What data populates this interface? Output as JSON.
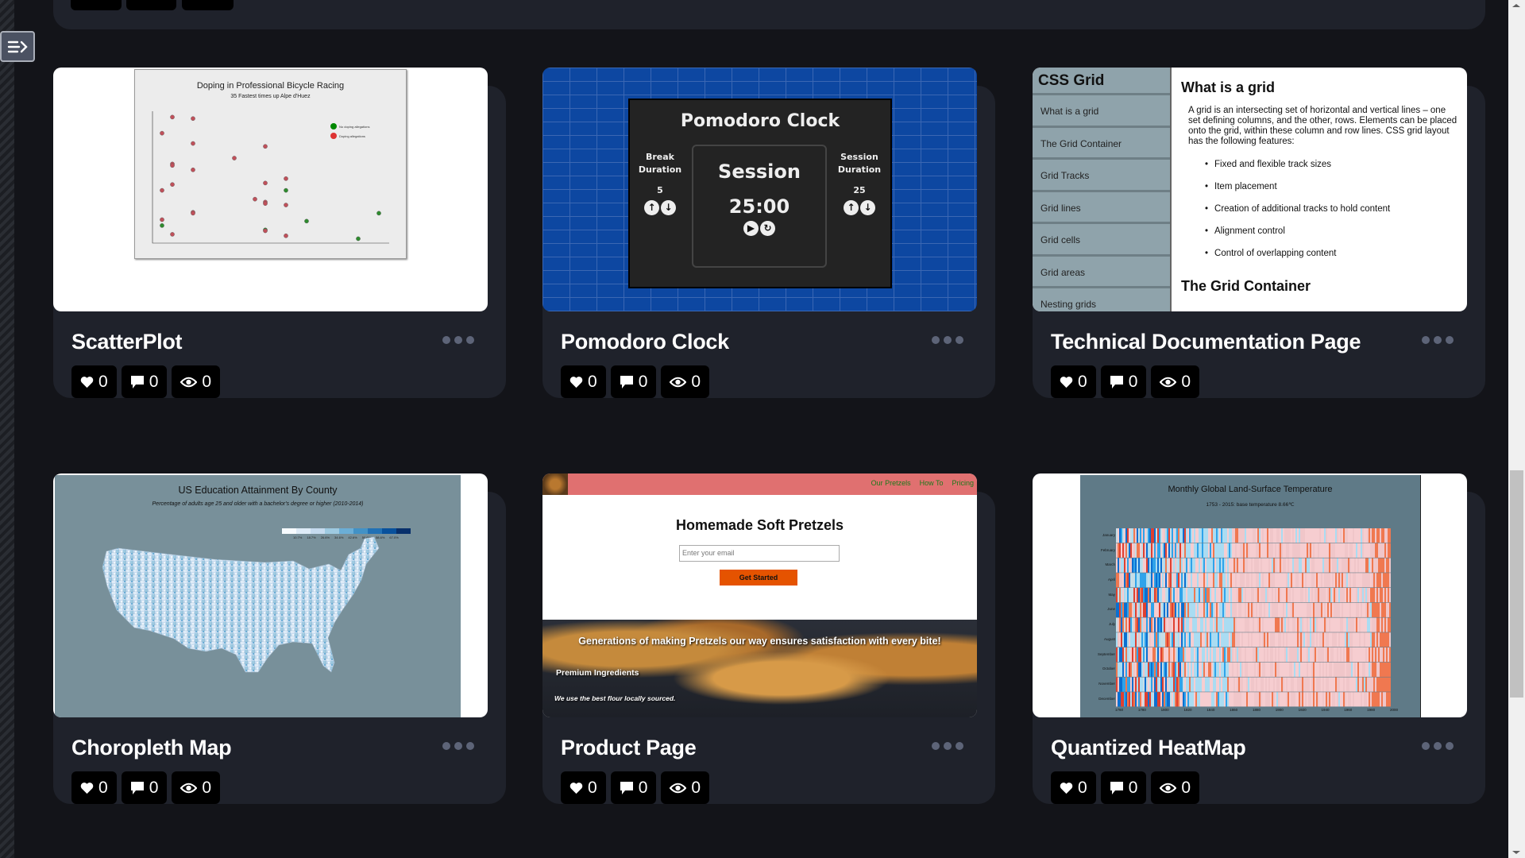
{
  "sidebar_toggle": {
    "icon": "menu-arrow-icon"
  },
  "cards": [
    {
      "title": "ScatterPlot",
      "likes": "0",
      "comments": "0",
      "views": "0"
    },
    {
      "title": "Pomodoro Clock",
      "likes": "0",
      "comments": "0",
      "views": "0"
    },
    {
      "title": "Technical Documentation Page",
      "likes": "0",
      "comments": "0",
      "views": "0"
    },
    {
      "title": "Choropleth Map",
      "likes": "0",
      "comments": "0",
      "views": "0"
    },
    {
      "title": "Product Page",
      "likes": "0",
      "comments": "0",
      "views": "0"
    },
    {
      "title": "Quantized HeatMap",
      "likes": "0",
      "comments": "0",
      "views": "0"
    }
  ],
  "scatter": {
    "title": "Doping in Professional Bicycle Racing",
    "subtitle": "35 Fastest times up Alpe d'Huez",
    "legend": [
      "No doping allegations",
      "Doping allegations"
    ],
    "colors": {
      "clean": "#2e8b2e",
      "doping": "#c0505a"
    },
    "points": [
      [
        1995,
        36.7,
        1
      ],
      [
        1997,
        36.75,
        1
      ],
      [
        1994,
        37.25,
        1
      ],
      [
        2004,
        37.7,
        1
      ],
      [
        1997,
        37.6,
        1
      ],
      [
        2001,
        38.1,
        1
      ],
      [
        1995,
        38.3,
        1
      ],
      [
        1995,
        38.35,
        1
      ],
      [
        1997,
        38.5,
        1
      ],
      [
        2006,
        38.8,
        1
      ],
      [
        2004,
        38.95,
        1
      ],
      [
        1995,
        39.0,
        1
      ],
      [
        1994,
        39.2,
        1
      ],
      [
        2006,
        39.2,
        0
      ],
      [
        2003,
        39.5,
        1
      ],
      [
        2004,
        39.6,
        1
      ],
      [
        2004,
        39.65,
        1
      ],
      [
        2006,
        39.7,
        1
      ],
      [
        1997,
        39.95,
        1
      ],
      [
        1997,
        39.98,
        1
      ],
      [
        2015,
        39.98,
        0
      ],
      [
        1994,
        40.2,
        1
      ],
      [
        2008,
        40.25,
        0
      ],
      [
        1994,
        40.4,
        0
      ],
      [
        2004,
        40.55,
        0
      ],
      [
        2004,
        40.58,
        1
      ],
      [
        1995,
        40.7,
        1
      ],
      [
        2006,
        40.75,
        1
      ],
      [
        2013,
        40.85,
        0
      ]
    ]
  },
  "pomodoro": {
    "title": "Pomodoro Clock",
    "break_label": "Break Duration",
    "break_value": "5",
    "session_label": "Session Duration",
    "session_value": "25",
    "mode": "Session",
    "time": "25:00"
  },
  "techdoc": {
    "sidebar_title": "CSS Grid",
    "nav": [
      "What is a grid",
      "The Grid Container",
      "Grid Tracks",
      "Grid lines",
      "Grid cells",
      "Grid areas",
      "Nesting grids"
    ],
    "heading": "What is a grid",
    "paragraph": "A grid is an intersecting set of horizontal and vertical lines – one set defining columns, and the other, rows. Elements can be placed onto the grid, within these column and row lines. CSS grid layout has the following features:",
    "features": [
      "Fixed and flexible track sizes",
      "Item placement",
      "Creation of additional tracks to hold content",
      "Alignment control",
      "Control of overlapping content"
    ],
    "heading2": "The Grid Container"
  },
  "choropleth": {
    "title": "US Education Attainment By County",
    "subtitle": "Percentage of adults age 25 and older with a bachelor's degree or higher (2010-2014)",
    "legend_colors": [
      "#f7fbff",
      "#deebf7",
      "#c6dbef",
      "#9ecae1",
      "#6baed6",
      "#4292c6",
      "#2171b5",
      "#08519c",
      "#08306b"
    ],
    "legend_ticks": [
      "10.7%",
      "18.7%",
      "26.6%",
      "34.6%",
      "42.6%",
      "50.6%",
      "58.6%",
      "67.0%"
    ]
  },
  "product": {
    "nav_links": [
      "Our Pretzels",
      "How To",
      "Pricing"
    ],
    "heading": "Homemade Soft Pretzels",
    "email_placeholder": "Enter your email",
    "cta": "Get Started",
    "tagline": "Generations of making Pretzels our way ensures satisfaction with every bite!",
    "feature_title": "Premium Ingredients",
    "feature_text": "We use the best flour locally sourced."
  },
  "heatmap": {
    "title": "Monthly Global Land-Surface Temperature",
    "subtitle": "1753 - 2015: base temperature 8.66℃",
    "months": [
      "January",
      "February",
      "March",
      "April",
      "May",
      "June",
      "July",
      "August",
      "September",
      "October",
      "November",
      "December"
    ],
    "years": [
      "1760",
      "1780",
      "1800",
      "1820",
      "1840",
      "1860",
      "1880",
      "1900",
      "1920",
      "1940",
      "1960",
      "1980",
      "2000"
    ],
    "palette": [
      "#0b6fd1",
      "#2fa3ea",
      "#aadcf2",
      "#c6dde6",
      "#f6cdd0",
      "#f0c6c9",
      "#f07850",
      "#e04030"
    ]
  }
}
